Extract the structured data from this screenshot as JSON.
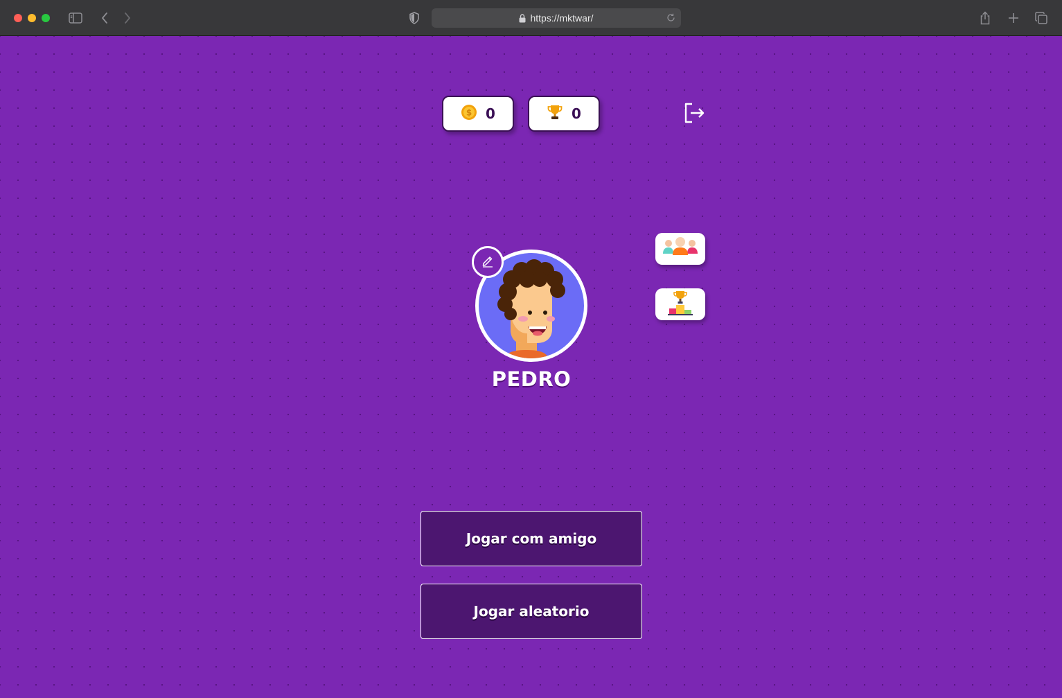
{
  "browser": {
    "url": "https://mktwar/"
  },
  "stats": {
    "coins": "0",
    "trophies": "0"
  },
  "profile": {
    "name": "PEDRO"
  },
  "actions": {
    "play_with_friend": "Jogar com amigo",
    "play_random": "Jogar aleatorio"
  },
  "icons": {
    "coins": "coin-icon",
    "trophies": "trophy-icon",
    "logout": "logout-icon",
    "friends": "friends-icon",
    "ranking": "podium-icon",
    "edit": "pencil-icon"
  },
  "colors": {
    "background": "#7b27b3",
    "button_fill": "#4c1670",
    "pill_border": "#3a0f55",
    "avatar_bg": "#6b6cf6"
  }
}
